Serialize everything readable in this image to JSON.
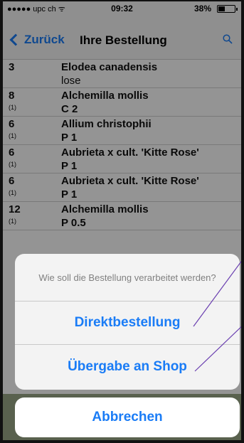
{
  "status_bar": {
    "carrier": "●●●●● upc ch ᯤ",
    "time": "09:32",
    "battery": "38%"
  },
  "navbar": {
    "back_label": "Zurück",
    "title": "Ihre Bestellung"
  },
  "rows": [
    {
      "qty": "3",
      "sub": "",
      "name": "Elodea canadensis",
      "code": "lose",
      "plain": true
    },
    {
      "qty": "8",
      "sub": "(1)",
      "name": "Alchemilla mollis",
      "code": "C 2"
    },
    {
      "qty": "6",
      "sub": "(1)",
      "name": "Allium christophii",
      "code": "P 1"
    },
    {
      "qty": "6",
      "sub": "(1)",
      "name": "Aubrieta x cult. 'Kitte Rose'",
      "code": "P 1"
    },
    {
      "qty": "6",
      "sub": "(1)",
      "name": "Aubrieta x cult. 'Kitte Rose'",
      "code": "P 1"
    },
    {
      "qty": "12",
      "sub": "(1)",
      "name": "Alchemilla mollis",
      "code": "P 0.5"
    }
  ],
  "action_sheet": {
    "message": "Wie soll die Bestellung verarbeitet werden?",
    "option_direct": "Direktbestellung",
    "option_shop": "Übergabe an Shop",
    "cancel": "Abbrechen"
  },
  "colors": {
    "accent": "#1a7cf6",
    "annotation": "#6a3fb0"
  }
}
